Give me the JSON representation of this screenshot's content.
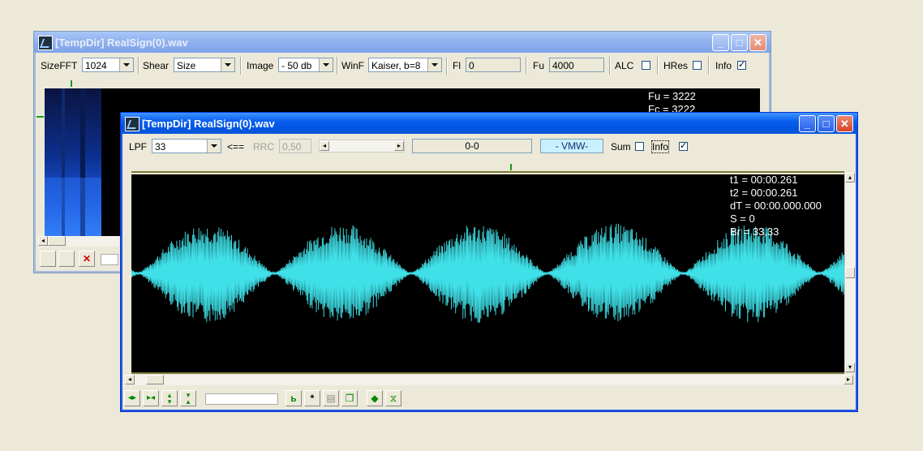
{
  "back_window": {
    "title": "[TempDir] RealSign(0).wav",
    "toolbar": {
      "sizefft_label": "SizeFFT",
      "sizefft_value": "1024",
      "shear_label": "Shear",
      "shear_value": "Size",
      "image_label": "Image",
      "image_value": "- 50 db",
      "winf_label": "WinF",
      "winf_value": "Kaiser, b=8",
      "fl_label": "Fl",
      "fl_value": "0",
      "fu_label": "Fu",
      "fu_value": "4000",
      "alc_label": "ALC",
      "hres_label": "HRes",
      "info_label": "Info",
      "info_checked": true
    },
    "overlay": {
      "line1": "Fu = 3222",
      "line2": "Fc = 3222"
    }
  },
  "front_window": {
    "title": "[TempDir] RealSign(0).wav",
    "toolbar": {
      "lpf_label": "LPF",
      "lpf_value": "33",
      "arrow_label": "<==",
      "rrc_label": "RRC",
      "rrc_value": "0,50",
      "range_text": "0-0",
      "mode_text": "- VMW-",
      "sum_label": "Sum",
      "info_label": "Info",
      "info_checked": true
    },
    "overlay": {
      "t1": "t1 = 00:00.261",
      "t2": "t2 = 00:00.261",
      "dt": "dT = 00:00.000.000",
      "s": "S = 0",
      "br": "Br = 33,33"
    },
    "waveform": {
      "color": "#40E0E8",
      "lobes": 6
    }
  },
  "colors": {
    "desktop": "#ECE9D8",
    "titlebar_active": "#0054E3",
    "plot_bg": "#000000",
    "trace": "#40E0E8",
    "mode_box": "#C8F0FF"
  }
}
